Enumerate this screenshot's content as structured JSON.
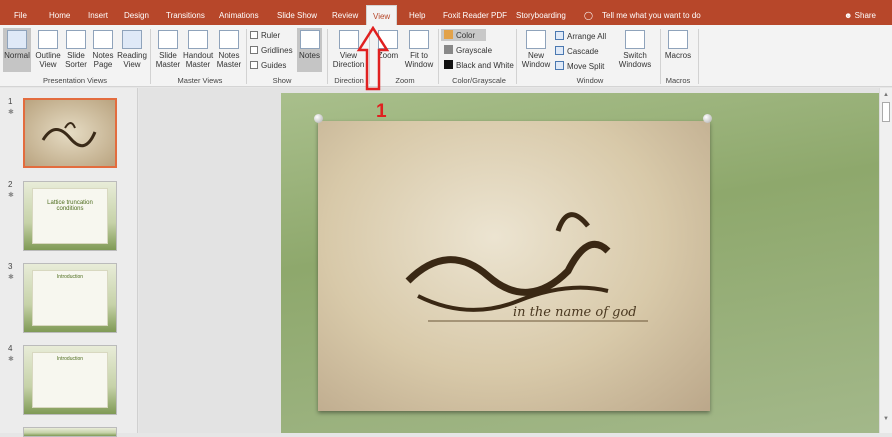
{
  "tabs": [
    "File",
    "Home",
    "Insert",
    "Design",
    "Transitions",
    "Animations",
    "Slide Show",
    "Review",
    "View",
    "Help",
    "Foxit Reader PDF",
    "Storyboarding"
  ],
  "active_tab": "View",
  "tell_me": "Tell me what you want to do",
  "share": "Share",
  "ribbon": {
    "presentation_views": {
      "label": "Presentation Views",
      "buttons": [
        "Normal",
        "Outline View",
        "Slide Sorter",
        "Notes Page",
        "Reading View"
      ]
    },
    "master_views": {
      "label": "Master Views",
      "buttons": [
        "Slide Master",
        "Handout Master",
        "Notes Master"
      ]
    },
    "show": {
      "label": "Show",
      "checks": [
        "Ruler",
        "Gridlines",
        "Guides"
      ],
      "notes": "Notes"
    },
    "direction": {
      "label": "Direction",
      "button": "View Direction"
    },
    "zoom": {
      "label": "Zoom",
      "buttons": [
        "Zoom",
        "Fit to Window"
      ]
    },
    "color": {
      "label": "Color/Grayscale",
      "items": [
        "Color",
        "Grayscale",
        "Black and White"
      ]
    },
    "window": {
      "label": "Window",
      "new_window": "New Window",
      "items": [
        "Arrange All",
        "Cascade",
        "Move Split"
      ]
    },
    "switch": "Switch Windows",
    "macros": {
      "label": "Macros",
      "button": "Macros"
    }
  },
  "slides": [
    {
      "num": "1",
      "title": ""
    },
    {
      "num": "2",
      "title": "Lattice truncation conditions"
    },
    {
      "num": "3",
      "title": "Introduction"
    },
    {
      "num": "4",
      "title": "Introduction"
    }
  ],
  "slide_caption": "in the name of god",
  "annotation": "1",
  "colors": {
    "accent": "#b7472a",
    "annotation": "#e02020"
  }
}
